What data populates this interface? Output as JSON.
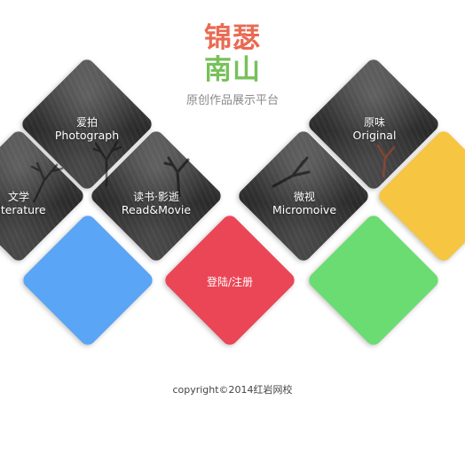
{
  "header": {
    "logo_line1": "锦瑟",
    "logo_line2": "南山",
    "tagline": "原创作品展示平台"
  },
  "tiles": {
    "photograph": {
      "cn": "爱拍",
      "en": "Photograph"
    },
    "literature": {
      "cn": "文学",
      "en": "Literature"
    },
    "read_movie": {
      "cn": "读书·影逝",
      "en": "Read&Movie"
    },
    "login": {
      "label": "登陆/注册"
    },
    "micromovie": {
      "cn": "微视",
      "en": "Micromoive"
    },
    "original": {
      "cn": "原味",
      "en": "Original"
    }
  },
  "colors": {
    "logo_line1": "#e96a53",
    "logo_line2": "#77c15a",
    "blue_tile": "#5aa5f5",
    "red_tile": "#ea4656",
    "green_tile": "#6adc72",
    "yellow_tile": "#f6c542",
    "dark_tile": "#333333"
  },
  "footer": {
    "copyright": "copyright©2014红岩网校"
  }
}
